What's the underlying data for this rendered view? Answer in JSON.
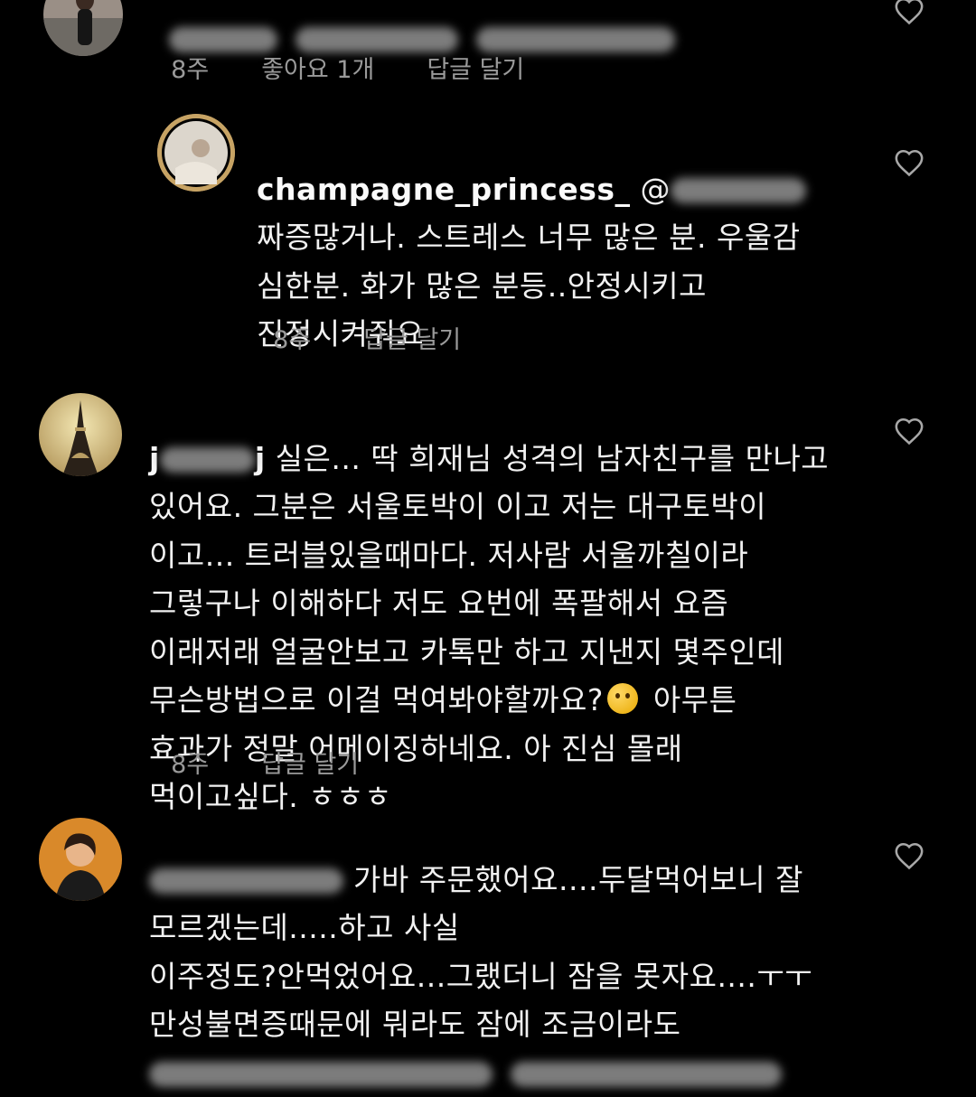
{
  "comments": [
    {
      "meta": {
        "time": "8주",
        "likes": "좋아요 1개",
        "reply": "답글 달기"
      }
    },
    {
      "username": "champagne_princess_",
      "mention": "@",
      "lines": [
        "짜증많거나. 스트레스 너무 많은 분. 우울감",
        "심한분. 화가 많은 분등..안정시키고",
        "진정시켜줘요"
      ],
      "meta": {
        "time": "8주",
        "reply": "답글 달기"
      }
    },
    {
      "username_prefix": "j",
      "username_suffix": "j",
      "line1": "실은... 딱 희재님 성격의 남자친구를 만나고",
      "lines": [
        "있어요. 그분은 서울토박이 이고 저는 대구토박이",
        "이고... 트러블있을때마다. 저사람 서울까칠이라",
        "그렇구나 이해하다 저도 요번에 폭팔해서 요즘",
        "이래저래 얼굴안보고 카톡만 하고 지낸지 몇주인데"
      ],
      "line_emoji_before": "무슨방법으로 이걸 먹여봐야할까요?",
      "line_emoji_after": "아무튼",
      "emoji": "thinking-face-emoji",
      "lines2": [
        "효과가 정말 어메이징하네요. 아 진심 몰래",
        "먹이고싶다. ㅎㅎㅎ"
      ],
      "meta": {
        "time": "8주",
        "reply": "답글 달기"
      }
    },
    {
      "line1": "가바 주문했어요....두달먹어보니 잘",
      "lines": [
        "모르겠는데.....하고 사실",
        "이주정도?안먹었어요...그랬더니 잠을 못자요....ㅜㅜ",
        "만성불면증때문에 뭐라도 잠에 조금이라도"
      ]
    }
  ],
  "icons": {
    "like": "heart-outline-icon"
  }
}
